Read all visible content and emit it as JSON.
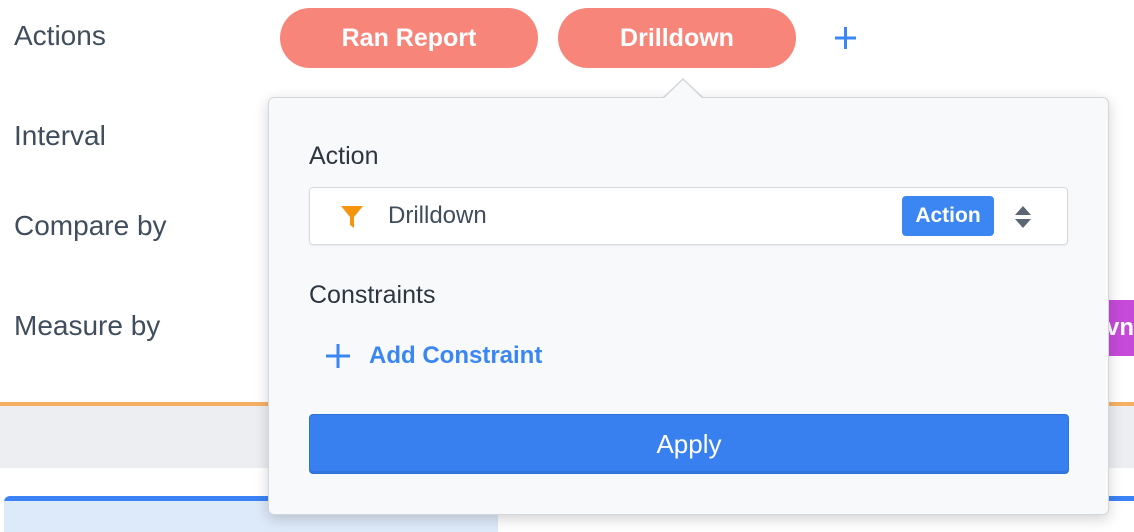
{
  "form": {
    "labels": {
      "actions": "Actions",
      "interval": "Interval",
      "compare_by": "Compare by",
      "measure_by": "Measure by"
    },
    "action_pills": [
      {
        "label": "Ran Report"
      },
      {
        "label": "Drilldown"
      }
    ],
    "add_action_icon": "plus-icon",
    "measure_chip_partial_text": "vn"
  },
  "popover": {
    "action_section_label": "Action",
    "action_select": {
      "icon": "funnel-icon",
      "value": "Drilldown",
      "badge": "Action",
      "toggle_icon": "sort-updown-icon"
    },
    "constraints_section_label": "Constraints",
    "add_constraint_label": "Add Constraint",
    "apply_label": "Apply"
  },
  "colors": {
    "pill": "#f7857a",
    "accent_blue": "#3a86f3",
    "funnel": "#f5940e",
    "purple_chip": "#c64ad9",
    "divider_orange": "#f6b064"
  }
}
